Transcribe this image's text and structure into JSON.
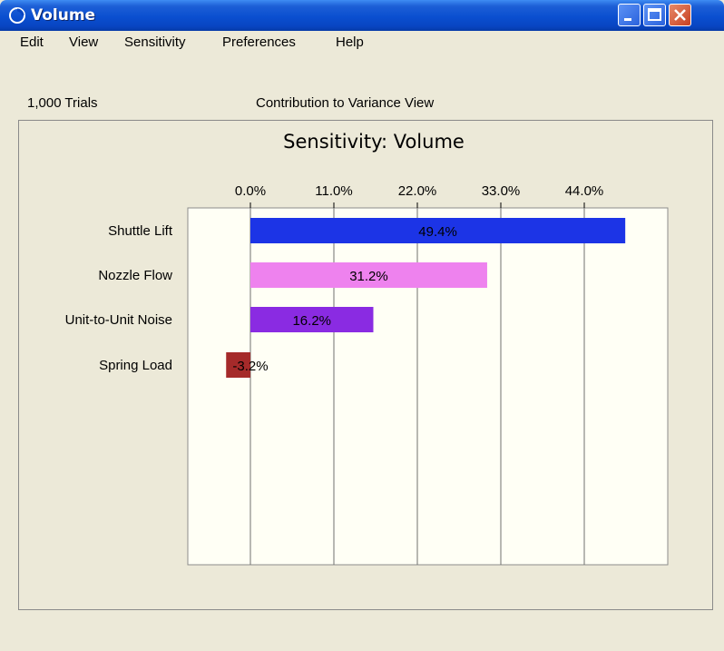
{
  "window": {
    "title": "Volume",
    "title_icon": "crystal-ball-logo-icon"
  },
  "title_controls": {
    "minimize_icon": "minimize-icon",
    "maximize_icon": "maximize-icon",
    "close_icon": "close-icon"
  },
  "menu": {
    "items": [
      "Edit",
      "View",
      "Sensitivity",
      "Preferences",
      "Help"
    ]
  },
  "info": {
    "trials": "1,000 Trials",
    "view_name": "Contribution to Variance View"
  },
  "chart_data": {
    "type": "bar",
    "orientation": "horizontal",
    "title": "Sensitivity: Volume",
    "categories": [
      "Shuttle Lift",
      "Nozzle Flow",
      "Unit-to-Unit Noise",
      "Spring Load"
    ],
    "values": [
      49.4,
      31.2,
      16.2,
      -3.2
    ],
    "value_labels": [
      "49.4%",
      "31.2%",
      "16.2%",
      "-3.2%"
    ],
    "colors": [
      "#1c34e6",
      "#ee82ee",
      "#8a2be2",
      "#a52a2a"
    ],
    "x_ticks": [
      0,
      11,
      22,
      33,
      44
    ],
    "x_tick_labels": [
      "0.0%",
      "11.0%",
      "22.0%",
      "33.0%",
      "44.0%"
    ],
    "xlim": [
      -8.25,
      55
    ],
    "xlabel": "",
    "ylabel": "",
    "grid": true,
    "axis_position": "top",
    "plot_background": "#fffff5"
  }
}
